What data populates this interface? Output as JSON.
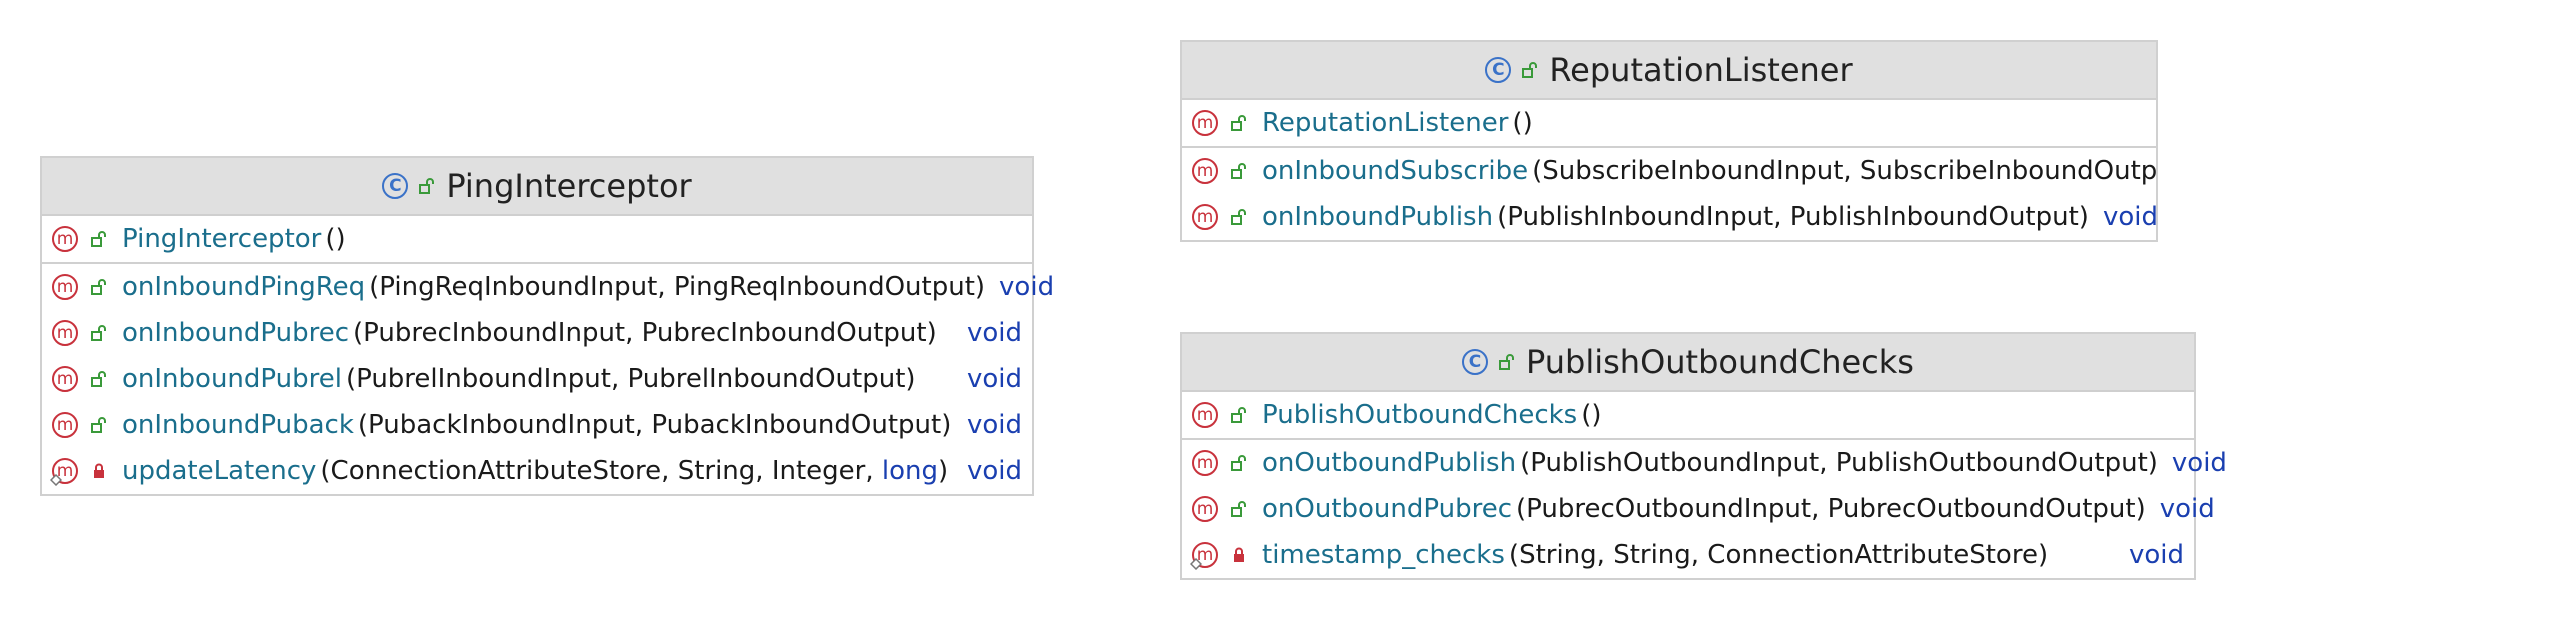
{
  "diagram": {
    "classes": [
      {
        "key": "ping",
        "name": "PingInterceptor",
        "constructors": [
          {
            "name": "PingInterceptor",
            "params": "()",
            "return": "",
            "visibility": "public",
            "static": false
          }
        ],
        "methods": [
          {
            "name": "onInboundPingReq",
            "params": "(PingReqInboundInput, PingReqInboundOutput)",
            "return": "void",
            "visibility": "public",
            "static": false
          },
          {
            "name": "onInboundPubrec",
            "params": "(PubrecInboundInput, PubrecInboundOutput)",
            "return": "void",
            "visibility": "public",
            "static": false
          },
          {
            "name": "onInboundPubrel",
            "params": "(PubrelInboundInput, PubrelInboundOutput)",
            "return": "void",
            "visibility": "public",
            "static": false
          },
          {
            "name": "onInboundPuback",
            "params": "(PubackInboundInput, PubackInboundOutput)",
            "return": "void",
            "visibility": "public",
            "static": false
          },
          {
            "name": "updateLatency",
            "params_parts": [
              "(ConnectionAttributeStore, String, Integer, ",
              "long",
              ")"
            ],
            "return": "void",
            "visibility": "private",
            "static": true
          }
        ]
      },
      {
        "key": "reputation",
        "name": "ReputationListener",
        "constructors": [
          {
            "name": "ReputationListener",
            "params": "()",
            "return": "",
            "visibility": "public",
            "static": false
          }
        ],
        "methods": [
          {
            "name": "onInboundSubscribe",
            "params": "(SubscribeInboundInput, SubscribeInboundOutput)",
            "return": "",
            "visibility": "public",
            "static": false
          },
          {
            "name": "onInboundPublish",
            "params": "(PublishInboundInput, PublishInboundOutput)",
            "return": "void",
            "visibility": "public",
            "static": false
          }
        ]
      },
      {
        "key": "publish",
        "name": "PublishOutboundChecks",
        "constructors": [
          {
            "name": "PublishOutboundChecks",
            "params": "()",
            "return": "",
            "visibility": "public",
            "static": false
          }
        ],
        "methods": [
          {
            "name": "onOutboundPublish",
            "params": "(PublishOutboundInput, PublishOutboundOutput)",
            "return": "void",
            "visibility": "public",
            "static": false
          },
          {
            "name": "onOutboundPubrec",
            "params": "(PubrecOutboundInput, PubrecOutboundOutput)",
            "return": "void",
            "visibility": "public",
            "static": false
          },
          {
            "name": "timestamp_checks",
            "params": "(String, String, ConnectionAttributeStore)",
            "return": "void",
            "visibility": "private",
            "static": true
          }
        ]
      }
    ],
    "icons": {
      "class": "C",
      "method": "m"
    },
    "colors": {
      "method_name": "#1a6e8c",
      "keyword": "#1a3fb0",
      "method_icon": "#c8323c",
      "class_icon": "#3a72c8",
      "public": "#3a9a3a",
      "private": "#c8323c",
      "header_bg": "#e0e0e0"
    }
  }
}
